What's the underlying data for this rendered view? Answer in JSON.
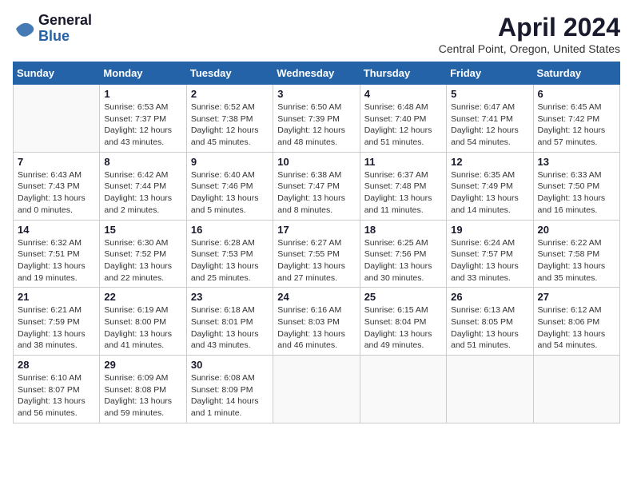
{
  "app": {
    "name_general": "General",
    "name_blue": "Blue"
  },
  "header": {
    "title": "April 2024",
    "location": "Central Point, Oregon, United States"
  },
  "calendar": {
    "days_of_week": [
      "Sunday",
      "Monday",
      "Tuesday",
      "Wednesday",
      "Thursday",
      "Friday",
      "Saturday"
    ],
    "weeks": [
      [
        {
          "day": "",
          "sunrise": "",
          "sunset": "",
          "daylight": ""
        },
        {
          "day": "1",
          "sunrise": "Sunrise: 6:53 AM",
          "sunset": "Sunset: 7:37 PM",
          "daylight": "Daylight: 12 hours and 43 minutes."
        },
        {
          "day": "2",
          "sunrise": "Sunrise: 6:52 AM",
          "sunset": "Sunset: 7:38 PM",
          "daylight": "Daylight: 12 hours and 45 minutes."
        },
        {
          "day": "3",
          "sunrise": "Sunrise: 6:50 AM",
          "sunset": "Sunset: 7:39 PM",
          "daylight": "Daylight: 12 hours and 48 minutes."
        },
        {
          "day": "4",
          "sunrise": "Sunrise: 6:48 AM",
          "sunset": "Sunset: 7:40 PM",
          "daylight": "Daylight: 12 hours and 51 minutes."
        },
        {
          "day": "5",
          "sunrise": "Sunrise: 6:47 AM",
          "sunset": "Sunset: 7:41 PM",
          "daylight": "Daylight: 12 hours and 54 minutes."
        },
        {
          "day": "6",
          "sunrise": "Sunrise: 6:45 AM",
          "sunset": "Sunset: 7:42 PM",
          "daylight": "Daylight: 12 hours and 57 minutes."
        }
      ],
      [
        {
          "day": "7",
          "sunrise": "Sunrise: 6:43 AM",
          "sunset": "Sunset: 7:43 PM",
          "daylight": "Daylight: 13 hours and 0 minutes."
        },
        {
          "day": "8",
          "sunrise": "Sunrise: 6:42 AM",
          "sunset": "Sunset: 7:44 PM",
          "daylight": "Daylight: 13 hours and 2 minutes."
        },
        {
          "day": "9",
          "sunrise": "Sunrise: 6:40 AM",
          "sunset": "Sunset: 7:46 PM",
          "daylight": "Daylight: 13 hours and 5 minutes."
        },
        {
          "day": "10",
          "sunrise": "Sunrise: 6:38 AM",
          "sunset": "Sunset: 7:47 PM",
          "daylight": "Daylight: 13 hours and 8 minutes."
        },
        {
          "day": "11",
          "sunrise": "Sunrise: 6:37 AM",
          "sunset": "Sunset: 7:48 PM",
          "daylight": "Daylight: 13 hours and 11 minutes."
        },
        {
          "day": "12",
          "sunrise": "Sunrise: 6:35 AM",
          "sunset": "Sunset: 7:49 PM",
          "daylight": "Daylight: 13 hours and 14 minutes."
        },
        {
          "day": "13",
          "sunrise": "Sunrise: 6:33 AM",
          "sunset": "Sunset: 7:50 PM",
          "daylight": "Daylight: 13 hours and 16 minutes."
        }
      ],
      [
        {
          "day": "14",
          "sunrise": "Sunrise: 6:32 AM",
          "sunset": "Sunset: 7:51 PM",
          "daylight": "Daylight: 13 hours and 19 minutes."
        },
        {
          "day": "15",
          "sunrise": "Sunrise: 6:30 AM",
          "sunset": "Sunset: 7:52 PM",
          "daylight": "Daylight: 13 hours and 22 minutes."
        },
        {
          "day": "16",
          "sunrise": "Sunrise: 6:28 AM",
          "sunset": "Sunset: 7:53 PM",
          "daylight": "Daylight: 13 hours and 25 minutes."
        },
        {
          "day": "17",
          "sunrise": "Sunrise: 6:27 AM",
          "sunset": "Sunset: 7:55 PM",
          "daylight": "Daylight: 13 hours and 27 minutes."
        },
        {
          "day": "18",
          "sunrise": "Sunrise: 6:25 AM",
          "sunset": "Sunset: 7:56 PM",
          "daylight": "Daylight: 13 hours and 30 minutes."
        },
        {
          "day": "19",
          "sunrise": "Sunrise: 6:24 AM",
          "sunset": "Sunset: 7:57 PM",
          "daylight": "Daylight: 13 hours and 33 minutes."
        },
        {
          "day": "20",
          "sunrise": "Sunrise: 6:22 AM",
          "sunset": "Sunset: 7:58 PM",
          "daylight": "Daylight: 13 hours and 35 minutes."
        }
      ],
      [
        {
          "day": "21",
          "sunrise": "Sunrise: 6:21 AM",
          "sunset": "Sunset: 7:59 PM",
          "daylight": "Daylight: 13 hours and 38 minutes."
        },
        {
          "day": "22",
          "sunrise": "Sunrise: 6:19 AM",
          "sunset": "Sunset: 8:00 PM",
          "daylight": "Daylight: 13 hours and 41 minutes."
        },
        {
          "day": "23",
          "sunrise": "Sunrise: 6:18 AM",
          "sunset": "Sunset: 8:01 PM",
          "daylight": "Daylight: 13 hours and 43 minutes."
        },
        {
          "day": "24",
          "sunrise": "Sunrise: 6:16 AM",
          "sunset": "Sunset: 8:03 PM",
          "daylight": "Daylight: 13 hours and 46 minutes."
        },
        {
          "day": "25",
          "sunrise": "Sunrise: 6:15 AM",
          "sunset": "Sunset: 8:04 PM",
          "daylight": "Daylight: 13 hours and 49 minutes."
        },
        {
          "day": "26",
          "sunrise": "Sunrise: 6:13 AM",
          "sunset": "Sunset: 8:05 PM",
          "daylight": "Daylight: 13 hours and 51 minutes."
        },
        {
          "day": "27",
          "sunrise": "Sunrise: 6:12 AM",
          "sunset": "Sunset: 8:06 PM",
          "daylight": "Daylight: 13 hours and 54 minutes."
        }
      ],
      [
        {
          "day": "28",
          "sunrise": "Sunrise: 6:10 AM",
          "sunset": "Sunset: 8:07 PM",
          "daylight": "Daylight: 13 hours and 56 minutes."
        },
        {
          "day": "29",
          "sunrise": "Sunrise: 6:09 AM",
          "sunset": "Sunset: 8:08 PM",
          "daylight": "Daylight: 13 hours and 59 minutes."
        },
        {
          "day": "30",
          "sunrise": "Sunrise: 6:08 AM",
          "sunset": "Sunset: 8:09 PM",
          "daylight": "Daylight: 14 hours and 1 minute."
        },
        {
          "day": "",
          "sunrise": "",
          "sunset": "",
          "daylight": ""
        },
        {
          "day": "",
          "sunrise": "",
          "sunset": "",
          "daylight": ""
        },
        {
          "day": "",
          "sunrise": "",
          "sunset": "",
          "daylight": ""
        },
        {
          "day": "",
          "sunrise": "",
          "sunset": "",
          "daylight": ""
        }
      ]
    ]
  }
}
